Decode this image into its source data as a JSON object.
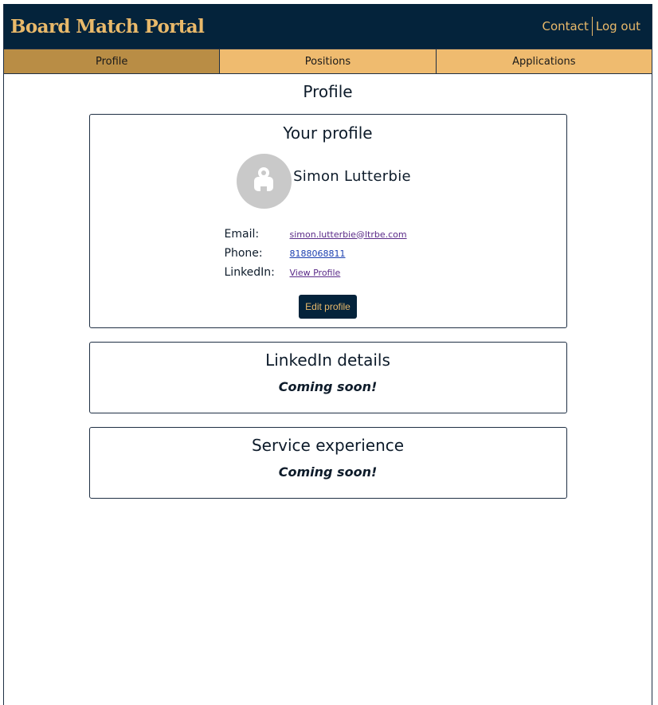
{
  "header": {
    "brand": "Board Match Portal",
    "contact_label": "Contact",
    "logout_label": "Log out"
  },
  "tabs": [
    {
      "label": "Profile",
      "active": true
    },
    {
      "label": "Positions",
      "active": false
    },
    {
      "label": "Applications",
      "active": false
    }
  ],
  "page": {
    "title": "Profile"
  },
  "profile_card": {
    "title": "Your profile",
    "name": "Simon Lutterbie",
    "email_label": "Email:",
    "email_value": "simon.lutterbie@ltrbe.com",
    "phone_label": "Phone:",
    "phone_value": "8188068811",
    "linkedin_label": "LinkedIn:",
    "linkedin_value": "View Profile",
    "edit_label": "Edit profile"
  },
  "linkedin_card": {
    "title": "LinkedIn details",
    "status": "Coming soon!"
  },
  "service_card": {
    "title": "Service experience",
    "status": "Coming soon!"
  },
  "colors": {
    "navy": "#04233b",
    "gold": "#e9b96a",
    "tab": "#efbb6f",
    "tab_active": "#b98d45"
  }
}
